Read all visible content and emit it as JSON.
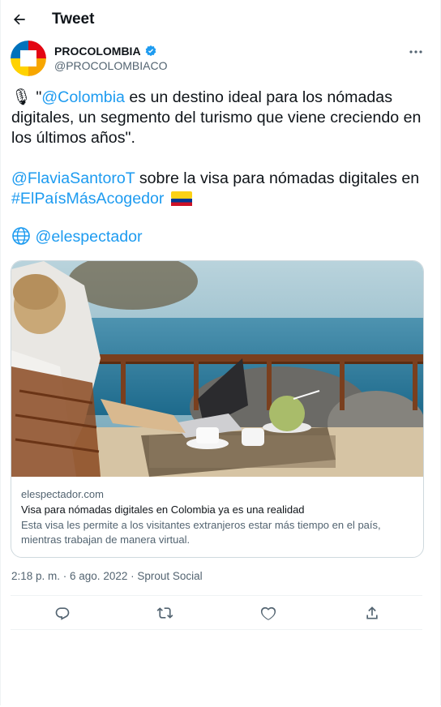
{
  "header": {
    "title": "Tweet",
    "back_icon": "arrow-left-icon"
  },
  "author": {
    "name": "PROCOLOMBIA",
    "handle": "@PROCOLOMBIACO",
    "verified": true
  },
  "tweet": {
    "p1_emoji": "🎙",
    "p1_quote_open": " \"",
    "p1_mention": "@Colombia",
    "p1_rest": " es un destino ideal para los nómadas digitales, un segmento del turismo que viene creciendo en los últimos años\".",
    "p2_mention": "@FlaviaSantoroT",
    "p2_text": " sobre la visa para nómadas digitales en ",
    "p2_hashtag": "#ElPaísMásAcogedor",
    "p3_source": "@elespectador"
  },
  "card": {
    "domain": "elespectador.com",
    "title": "Visa para nómadas digitales en Colombia ya es una realidad",
    "description": "Esta visa les permite a los visitantes extranjeros estar más tiempo en el país, mientras trabajan de manera virtual."
  },
  "meta": {
    "timestamp": "2:18 p. m. · 6 ago. 2022 · Sprout Social"
  },
  "actions": [
    "reply-icon",
    "retweet-icon",
    "like-icon",
    "share-icon"
  ],
  "colors": {
    "link": "#1d9bf0",
    "secondary_text": "#536471",
    "verified": "#1d9bf0"
  }
}
